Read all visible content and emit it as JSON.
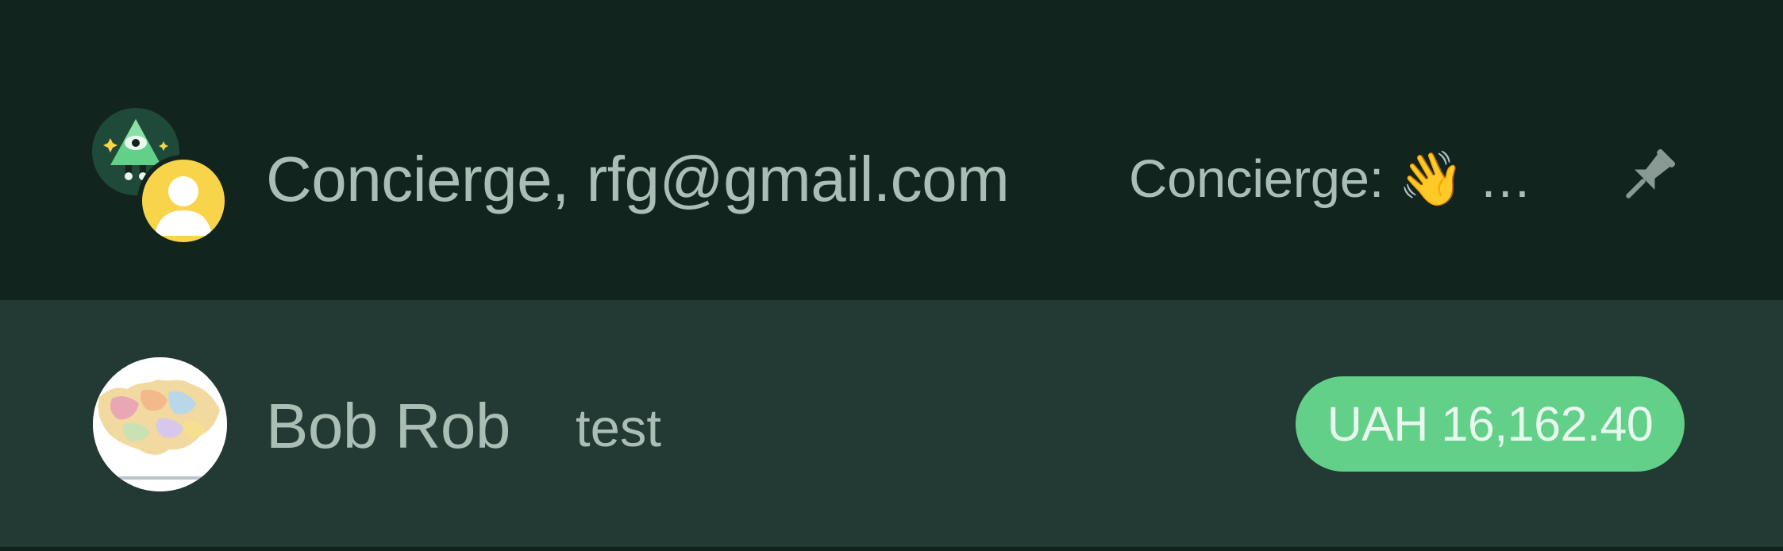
{
  "chats": [
    {
      "title": "Concierge, rfg@gmail.com",
      "preview": "Concierge: 👋 …",
      "pinned": true,
      "avatars": [
        "concierge-avatar",
        "default-user-avatar"
      ],
      "icon": "pin-icon"
    },
    {
      "title": "Bob Rob",
      "preview": "test",
      "amount": "UAH 16,162.40",
      "avatar": "map-avatar"
    }
  ],
  "colors": {
    "background": "#12241e",
    "highlight_row": "#223a33",
    "text": "#a9bfb6",
    "badge": "#63d089",
    "badge_text": "#e9f8ef",
    "user_avatar": "#f7d44a"
  }
}
